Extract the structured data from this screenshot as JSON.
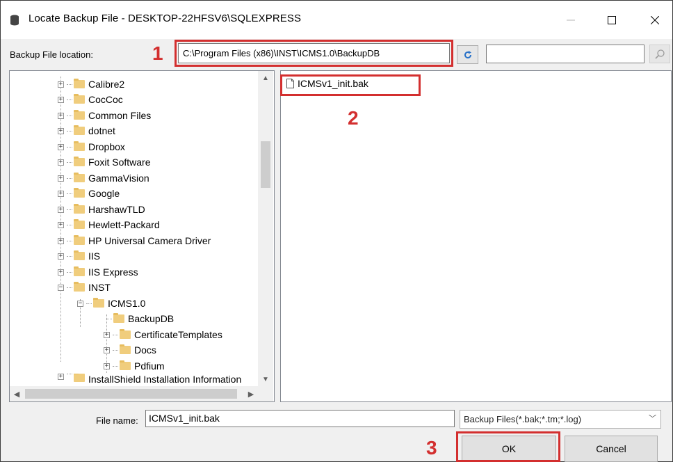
{
  "window": {
    "title": "Locate Backup File - DESKTOP-22HFSV6\\SQLEXPRESS",
    "minimize_icon": "minimize-icon",
    "maximize_icon": "maximize-icon",
    "close_icon": "close-icon"
  },
  "location": {
    "label": "Backup File location:",
    "value": "C:\\Program Files (x86)\\INST\\ICMS1.0\\BackupDB",
    "refresh_icon": "refresh-icon",
    "search_value": "",
    "search_icon": "search-icon"
  },
  "tree": {
    "items": [
      {
        "label": "Calibre2"
      },
      {
        "label": "CocCoc"
      },
      {
        "label": "Common Files"
      },
      {
        "label": "dotnet"
      },
      {
        "label": "Dropbox"
      },
      {
        "label": "Foxit Software"
      },
      {
        "label": "GammaVision"
      },
      {
        "label": "Google"
      },
      {
        "label": "HarshawTLD"
      },
      {
        "label": "Hewlett-Packard"
      },
      {
        "label": "HP Universal Camera Driver"
      },
      {
        "label": "IIS"
      },
      {
        "label": "IIS Express"
      },
      {
        "label": "INST"
      },
      {
        "label": "ICMS1.0"
      },
      {
        "label": "BackupDB"
      },
      {
        "label": "CertificateTemplates"
      },
      {
        "label": "Docs"
      },
      {
        "label": "Pdfium"
      },
      {
        "label": "InstallShield Installation Information"
      }
    ]
  },
  "files": [
    {
      "name": "ICMSv1_init.bak"
    }
  ],
  "bottom": {
    "file_name_label": "File name:",
    "file_name_value": "ICMSv1_init.bak",
    "file_type_value": "Backup Files(*.bak;*.tm;*.log)",
    "ok_label": "OK",
    "cancel_label": "Cancel"
  },
  "annotations": [
    "1",
    "2",
    "3"
  ],
  "colors": {
    "annotation": "#d32f2f",
    "folder": "#f0cd7d",
    "refresh_icon": "#2a72c8"
  }
}
